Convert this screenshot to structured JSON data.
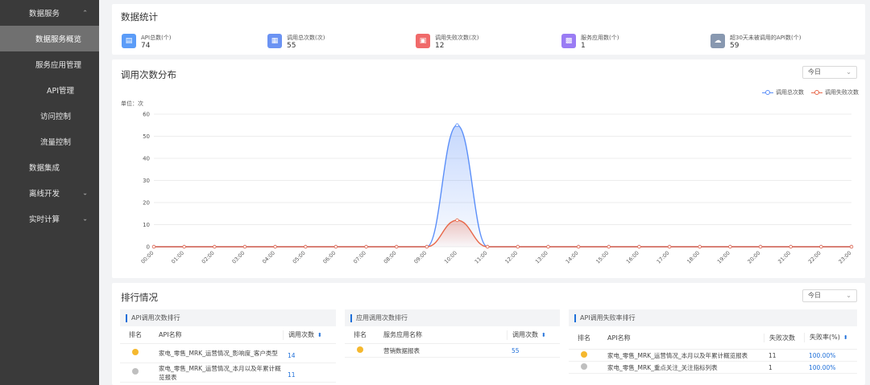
{
  "sidebar": {
    "items": [
      {
        "label": "数据服务",
        "chev": "⌃"
      },
      {
        "label": "数据服务概览",
        "active": true
      },
      {
        "label": "服务应用管理"
      },
      {
        "label": "API管理"
      },
      {
        "label": "访问控制"
      },
      {
        "label": "流量控制"
      },
      {
        "label": "数据集成"
      },
      {
        "label": "离线开发",
        "chev": "⌄"
      },
      {
        "label": "实时计算",
        "chev": "⌄"
      }
    ]
  },
  "stats": {
    "title": "数据统计",
    "items": [
      {
        "label": "API总数(个)",
        "value": "74",
        "color": "#5b9cf8",
        "icon": "folder-icon"
      },
      {
        "label": "调用总次数(次)",
        "value": "55",
        "color": "#6b93f3",
        "icon": "calendar-icon"
      },
      {
        "label": "调用失败次数(次)",
        "value": "12",
        "color": "#f06a6a",
        "icon": "error-doc-icon"
      },
      {
        "label": "服务应用数(个)",
        "value": "1",
        "color": "#9a7cf4",
        "icon": "grid-icon"
      },
      {
        "label": "超30天未被调用的API数(个)",
        "value": "59",
        "color": "#8898b0",
        "icon": "cloud-icon"
      }
    ]
  },
  "chart_section": {
    "title": "调用次数分布",
    "period": "今日",
    "unit_label": "单位：次"
  },
  "chart_data": {
    "type": "area",
    "categories": [
      "00:00",
      "01:00",
      "02:00",
      "03:00",
      "04:00",
      "05:00",
      "06:00",
      "07:00",
      "08:00",
      "09:00",
      "10:00",
      "11:00",
      "12:00",
      "13:00",
      "14:00",
      "15:00",
      "16:00",
      "17:00",
      "18:00",
      "19:00",
      "20:00",
      "21:00",
      "22:00",
      "23:00"
    ],
    "series": [
      {
        "name": "调用总次数",
        "color": "#5b8ff9",
        "values": [
          0,
          0,
          0,
          0,
          0,
          0,
          0,
          0,
          0,
          0,
          55,
          0,
          0,
          0,
          0,
          0,
          0,
          0,
          0,
          0,
          0,
          0,
          0,
          0
        ]
      },
      {
        "name": "调用失败次数",
        "color": "#e8684a",
        "values": [
          0,
          0,
          0,
          0,
          0,
          0,
          0,
          0,
          0,
          0,
          12,
          0,
          0,
          0,
          0,
          0,
          0,
          0,
          0,
          0,
          0,
          0,
          0,
          0
        ]
      }
    ],
    "y_ticks": [
      0,
      10,
      20,
      30,
      40,
      50,
      60
    ],
    "ylim": [
      0,
      60
    ],
    "legend_position": "top-right",
    "grid": true
  },
  "ranking": {
    "title": "排行情况",
    "period": "今日",
    "api_calls": {
      "title": "API调用次数排行",
      "headers": [
        "排名",
        "API名称",
        "调用次数"
      ],
      "rows": [
        {
          "rank_color": "#f5b82e",
          "name": "家电_零售_MRK_运营情况_影响度_客户类型",
          "value": "14"
        },
        {
          "rank_color": "#bfbfbf",
          "name": "家电_零售_MRK_运营情况_本月以及年累计概览报表",
          "value": "11"
        }
      ]
    },
    "app_calls": {
      "title": "应用调用次数排行",
      "headers": [
        "排名",
        "服务应用名称",
        "调用次数"
      ],
      "rows": [
        {
          "rank_color": "#f5b82e",
          "name": "营销数据报表",
          "value": "55"
        }
      ]
    },
    "api_fail": {
      "title": "API调用失败率排行",
      "headers": [
        "排名",
        "API名称",
        "失败次数",
        "失败率(%)"
      ],
      "rows": [
        {
          "rank_color": "#f5b82e",
          "name": "家电_零售_MRK_运营情况_本月以及年累计概览报表",
          "count": "11",
          "rate": "100.00%"
        },
        {
          "rank_color": "#bfbfbf",
          "name": "家电_零售_MRK_重点关注_关注指标列表",
          "count": "1",
          "rate": "100.00%"
        }
      ]
    }
  }
}
